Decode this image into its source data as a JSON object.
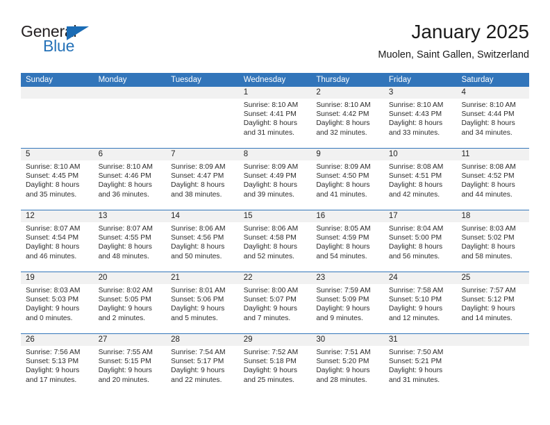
{
  "brand": {
    "name_part1": "General",
    "name_part2": "Blue"
  },
  "header": {
    "title": "January 2025",
    "subtitle": "Muolen, Saint Gallen, Switzerland"
  },
  "colors": {
    "header_blue": "#3275ba",
    "brand_blue": "#2572b8",
    "day_strip_gray": "#f1f1f1"
  },
  "weekdays": [
    "Sunday",
    "Monday",
    "Tuesday",
    "Wednesday",
    "Thursday",
    "Friday",
    "Saturday"
  ],
  "weeks": [
    [
      {
        "day": "",
        "sunrise": "",
        "sunset": "",
        "daylight1": "",
        "daylight2": "",
        "empty": true
      },
      {
        "day": "",
        "sunrise": "",
        "sunset": "",
        "daylight1": "",
        "daylight2": "",
        "empty": true
      },
      {
        "day": "",
        "sunrise": "",
        "sunset": "",
        "daylight1": "",
        "daylight2": "",
        "empty": true
      },
      {
        "day": "1",
        "sunrise": "Sunrise: 8:10 AM",
        "sunset": "Sunset: 4:41 PM",
        "daylight1": "Daylight: 8 hours",
        "daylight2": "and 31 minutes."
      },
      {
        "day": "2",
        "sunrise": "Sunrise: 8:10 AM",
        "sunset": "Sunset: 4:42 PM",
        "daylight1": "Daylight: 8 hours",
        "daylight2": "and 32 minutes."
      },
      {
        "day": "3",
        "sunrise": "Sunrise: 8:10 AM",
        "sunset": "Sunset: 4:43 PM",
        "daylight1": "Daylight: 8 hours",
        "daylight2": "and 33 minutes."
      },
      {
        "day": "4",
        "sunrise": "Sunrise: 8:10 AM",
        "sunset": "Sunset: 4:44 PM",
        "daylight1": "Daylight: 8 hours",
        "daylight2": "and 34 minutes."
      }
    ],
    [
      {
        "day": "5",
        "sunrise": "Sunrise: 8:10 AM",
        "sunset": "Sunset: 4:45 PM",
        "daylight1": "Daylight: 8 hours",
        "daylight2": "and 35 minutes."
      },
      {
        "day": "6",
        "sunrise": "Sunrise: 8:10 AM",
        "sunset": "Sunset: 4:46 PM",
        "daylight1": "Daylight: 8 hours",
        "daylight2": "and 36 minutes."
      },
      {
        "day": "7",
        "sunrise": "Sunrise: 8:09 AM",
        "sunset": "Sunset: 4:47 PM",
        "daylight1": "Daylight: 8 hours",
        "daylight2": "and 38 minutes."
      },
      {
        "day": "8",
        "sunrise": "Sunrise: 8:09 AM",
        "sunset": "Sunset: 4:49 PM",
        "daylight1": "Daylight: 8 hours",
        "daylight2": "and 39 minutes."
      },
      {
        "day": "9",
        "sunrise": "Sunrise: 8:09 AM",
        "sunset": "Sunset: 4:50 PM",
        "daylight1": "Daylight: 8 hours",
        "daylight2": "and 41 minutes."
      },
      {
        "day": "10",
        "sunrise": "Sunrise: 8:08 AM",
        "sunset": "Sunset: 4:51 PM",
        "daylight1": "Daylight: 8 hours",
        "daylight2": "and 42 minutes."
      },
      {
        "day": "11",
        "sunrise": "Sunrise: 8:08 AM",
        "sunset": "Sunset: 4:52 PM",
        "daylight1": "Daylight: 8 hours",
        "daylight2": "and 44 minutes."
      }
    ],
    [
      {
        "day": "12",
        "sunrise": "Sunrise: 8:07 AM",
        "sunset": "Sunset: 4:54 PM",
        "daylight1": "Daylight: 8 hours",
        "daylight2": "and 46 minutes."
      },
      {
        "day": "13",
        "sunrise": "Sunrise: 8:07 AM",
        "sunset": "Sunset: 4:55 PM",
        "daylight1": "Daylight: 8 hours",
        "daylight2": "and 48 minutes."
      },
      {
        "day": "14",
        "sunrise": "Sunrise: 8:06 AM",
        "sunset": "Sunset: 4:56 PM",
        "daylight1": "Daylight: 8 hours",
        "daylight2": "and 50 minutes."
      },
      {
        "day": "15",
        "sunrise": "Sunrise: 8:06 AM",
        "sunset": "Sunset: 4:58 PM",
        "daylight1": "Daylight: 8 hours",
        "daylight2": "and 52 minutes."
      },
      {
        "day": "16",
        "sunrise": "Sunrise: 8:05 AM",
        "sunset": "Sunset: 4:59 PM",
        "daylight1": "Daylight: 8 hours",
        "daylight2": "and 54 minutes."
      },
      {
        "day": "17",
        "sunrise": "Sunrise: 8:04 AM",
        "sunset": "Sunset: 5:00 PM",
        "daylight1": "Daylight: 8 hours",
        "daylight2": "and 56 minutes."
      },
      {
        "day": "18",
        "sunrise": "Sunrise: 8:03 AM",
        "sunset": "Sunset: 5:02 PM",
        "daylight1": "Daylight: 8 hours",
        "daylight2": "and 58 minutes."
      }
    ],
    [
      {
        "day": "19",
        "sunrise": "Sunrise: 8:03 AM",
        "sunset": "Sunset: 5:03 PM",
        "daylight1": "Daylight: 9 hours",
        "daylight2": "and 0 minutes."
      },
      {
        "day": "20",
        "sunrise": "Sunrise: 8:02 AM",
        "sunset": "Sunset: 5:05 PM",
        "daylight1": "Daylight: 9 hours",
        "daylight2": "and 2 minutes."
      },
      {
        "day": "21",
        "sunrise": "Sunrise: 8:01 AM",
        "sunset": "Sunset: 5:06 PM",
        "daylight1": "Daylight: 9 hours",
        "daylight2": "and 5 minutes."
      },
      {
        "day": "22",
        "sunrise": "Sunrise: 8:00 AM",
        "sunset": "Sunset: 5:07 PM",
        "daylight1": "Daylight: 9 hours",
        "daylight2": "and 7 minutes."
      },
      {
        "day": "23",
        "sunrise": "Sunrise: 7:59 AM",
        "sunset": "Sunset: 5:09 PM",
        "daylight1": "Daylight: 9 hours",
        "daylight2": "and 9 minutes."
      },
      {
        "day": "24",
        "sunrise": "Sunrise: 7:58 AM",
        "sunset": "Sunset: 5:10 PM",
        "daylight1": "Daylight: 9 hours",
        "daylight2": "and 12 minutes."
      },
      {
        "day": "25",
        "sunrise": "Sunrise: 7:57 AM",
        "sunset": "Sunset: 5:12 PM",
        "daylight1": "Daylight: 9 hours",
        "daylight2": "and 14 minutes."
      }
    ],
    [
      {
        "day": "26",
        "sunrise": "Sunrise: 7:56 AM",
        "sunset": "Sunset: 5:13 PM",
        "daylight1": "Daylight: 9 hours",
        "daylight2": "and 17 minutes."
      },
      {
        "day": "27",
        "sunrise": "Sunrise: 7:55 AM",
        "sunset": "Sunset: 5:15 PM",
        "daylight1": "Daylight: 9 hours",
        "daylight2": "and 20 minutes."
      },
      {
        "day": "28",
        "sunrise": "Sunrise: 7:54 AM",
        "sunset": "Sunset: 5:17 PM",
        "daylight1": "Daylight: 9 hours",
        "daylight2": "and 22 minutes."
      },
      {
        "day": "29",
        "sunrise": "Sunrise: 7:52 AM",
        "sunset": "Sunset: 5:18 PM",
        "daylight1": "Daylight: 9 hours",
        "daylight2": "and 25 minutes."
      },
      {
        "day": "30",
        "sunrise": "Sunrise: 7:51 AM",
        "sunset": "Sunset: 5:20 PM",
        "daylight1": "Daylight: 9 hours",
        "daylight2": "and 28 minutes."
      },
      {
        "day": "31",
        "sunrise": "Sunrise: 7:50 AM",
        "sunset": "Sunset: 5:21 PM",
        "daylight1": "Daylight: 9 hours",
        "daylight2": "and 31 minutes."
      },
      {
        "day": "",
        "sunrise": "",
        "sunset": "",
        "daylight1": "",
        "daylight2": "",
        "empty": true
      }
    ]
  ]
}
